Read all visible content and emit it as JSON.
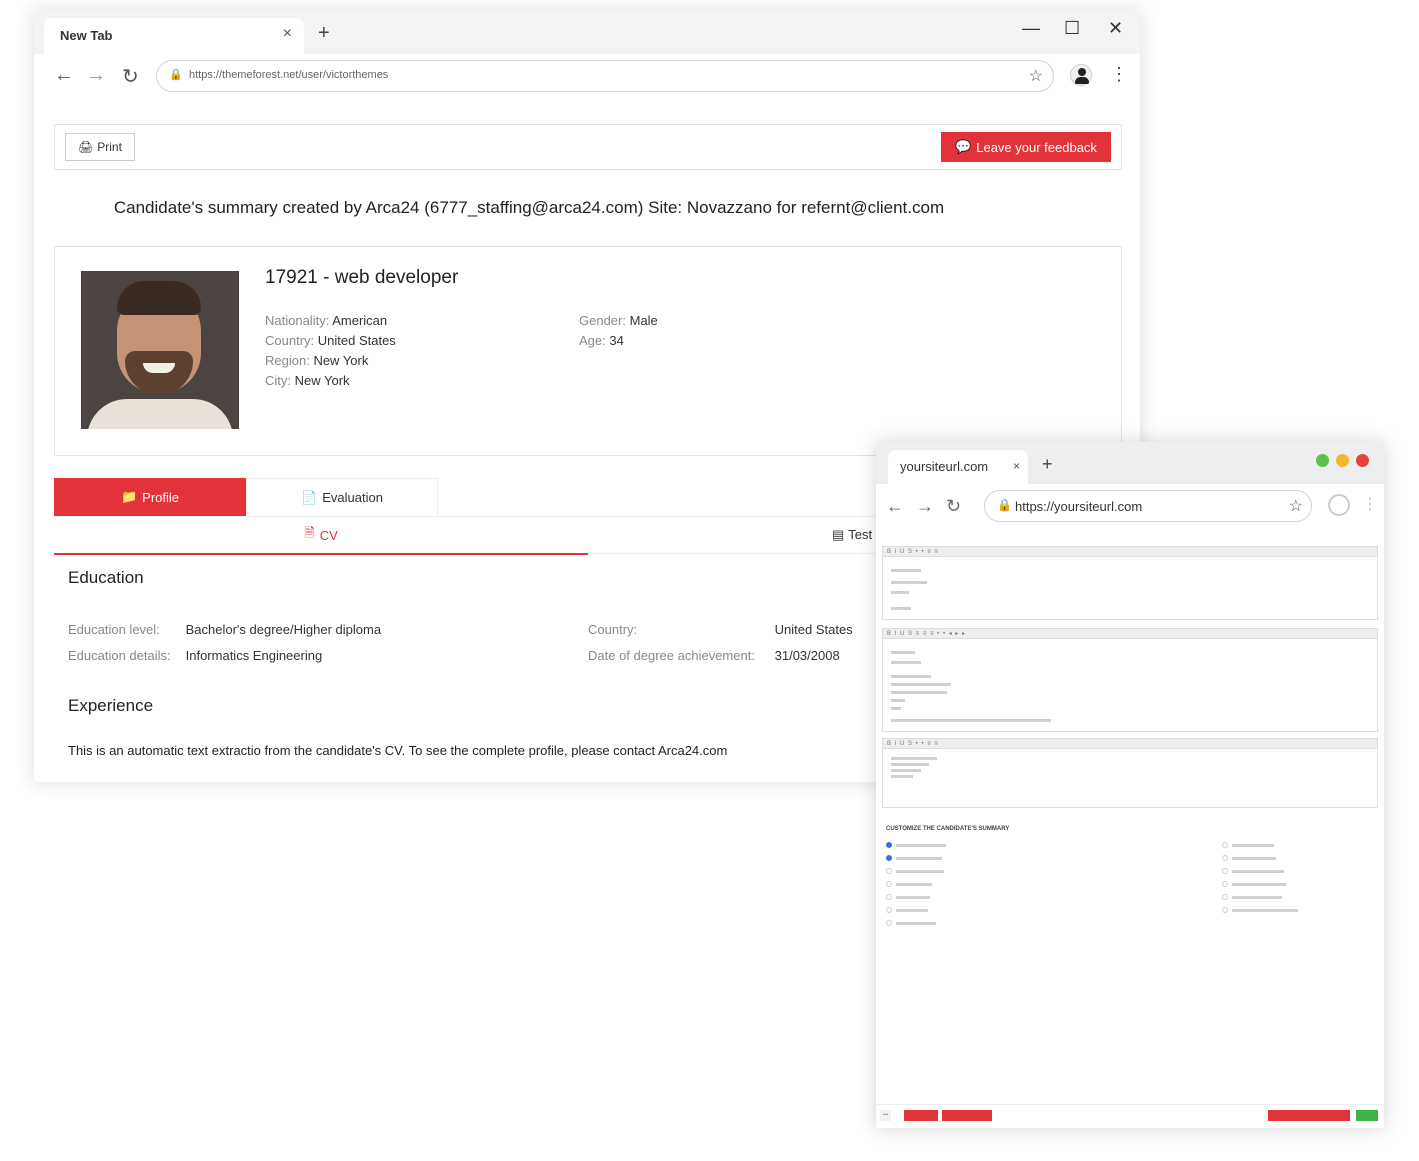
{
  "main_browser": {
    "tab_title": "New Tab",
    "tab_close": "×",
    "new_tab": "+",
    "minimize": "—",
    "maximize": "☐",
    "close": "✕",
    "url": "https://themeforest.net/user/victorthemes"
  },
  "actions": {
    "print_label": "Print",
    "feedback_label": "Leave your feedback"
  },
  "summary_line": "Candidate's summary created by Arca24 (6777_staffing@arca24.com) Site: Novazzano for refernt@client.com",
  "candidate": {
    "title": "17921 - web developer",
    "nationality_label": "Nationality:",
    "nationality": "American",
    "country_label": "Country:",
    "country": "United States",
    "region_label": "Region:",
    "region": "New York",
    "city_label": "City:",
    "city": "New York",
    "gender_label": "Gender:",
    "gender": "Male",
    "age_label": "Age:",
    "age": "34"
  },
  "tabs": {
    "profile": "Profile",
    "evaluation": "Evaluation",
    "cv": "CV",
    "tests": "Test"
  },
  "education": {
    "heading": "Education",
    "level_label": "Education level:",
    "level": "Bachelor's degree/Higher diploma",
    "details_label": "Education details:",
    "details": "Informatics Engineering",
    "country_label": "Country:",
    "country": "United States",
    "date_label": "Date of degree achievement:",
    "date": "31/03/2008"
  },
  "experience": {
    "heading": "Experience",
    "note": "This is an automatic text extractio from the candidate's CV. To see the complete profile, please contact Arca24.com"
  },
  "second_browser": {
    "tab_title": "yoursiteurl.com",
    "tab_close": "×",
    "new_tab": "+",
    "url": "https://yoursiteurl.com",
    "customize_heading": "CUSTOMIZE THE CANDIDATE'S SUMMARY",
    "dot_colors": [
      "#5fc04b",
      "#f5b72b",
      "#e3453d"
    ]
  },
  "colors": {
    "accent": "#e2333a"
  },
  "icons": {
    "print": "printer-icon",
    "feedback": "comments-icon",
    "profile": "folder-icon",
    "evaluation": "file-icon",
    "cv": "document-icon",
    "tests": "list-icon"
  }
}
